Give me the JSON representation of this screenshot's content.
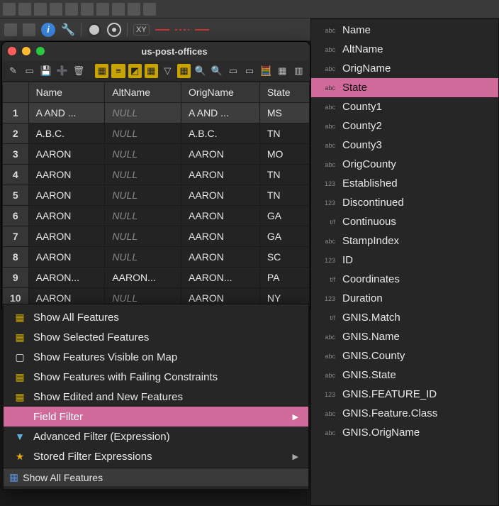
{
  "window": {
    "title": "us-post-offices"
  },
  "table": {
    "columns": [
      "Name",
      "AltName",
      "OrigName",
      "State"
    ],
    "rows": [
      {
        "n": "1",
        "Name": "A AND ...",
        "AltName": null,
        "OrigName": "A AND ...",
        "State": "MS",
        "selected": true
      },
      {
        "n": "2",
        "Name": "A.B.C.",
        "AltName": null,
        "OrigName": "A.B.C.",
        "State": "TN"
      },
      {
        "n": "3",
        "Name": "AARON",
        "AltName": null,
        "OrigName": "AARON",
        "State": "MO"
      },
      {
        "n": "4",
        "Name": "AARON",
        "AltName": null,
        "OrigName": "AARON",
        "State": "TN"
      },
      {
        "n": "5",
        "Name": "AARON",
        "AltName": null,
        "OrigName": "AARON",
        "State": "TN"
      },
      {
        "n": "6",
        "Name": "AARON",
        "AltName": null,
        "OrigName": "AARON",
        "State": "GA"
      },
      {
        "n": "7",
        "Name": "AARON",
        "AltName": null,
        "OrigName": "AARON",
        "State": "GA"
      },
      {
        "n": "8",
        "Name": "AARON",
        "AltName": null,
        "OrigName": "AARON",
        "State": "SC"
      },
      {
        "n": "9",
        "Name": "AARON...",
        "AltName": "AARON...",
        "OrigName": "AARON...",
        "State": "PA"
      },
      {
        "n": "10",
        "Name": "AARON",
        "AltName": null,
        "OrigName": "AARON",
        "State": "NY"
      }
    ],
    "null_label": "NULL"
  },
  "context_menu": {
    "items": [
      {
        "label": "Show All Features",
        "icon": "grid"
      },
      {
        "label": "Show Selected Features",
        "icon": "grid-sel"
      },
      {
        "label": "Show Features Visible on Map",
        "icon": "map"
      },
      {
        "label": "Show Features with Failing Constraints",
        "icon": "warn"
      },
      {
        "label": "Show Edited and New Features",
        "icon": "edit"
      },
      {
        "label": "Field Filter",
        "icon": "",
        "highlight": true,
        "submenu": true
      },
      {
        "label": "Advanced Filter (Expression)",
        "icon": "funnel"
      },
      {
        "label": "Stored Filter Expressions",
        "icon": "star",
        "submenu": true
      }
    ],
    "status": {
      "icon": "grid",
      "label": "Show All Features"
    }
  },
  "field_menu": {
    "items": [
      {
        "type": "abc",
        "label": "Name"
      },
      {
        "type": "abc",
        "label": "AltName"
      },
      {
        "type": "abc",
        "label": "OrigName"
      },
      {
        "type": "abc",
        "label": "State",
        "highlight": true
      },
      {
        "type": "abc",
        "label": "County1"
      },
      {
        "type": "abc",
        "label": "County2"
      },
      {
        "type": "abc",
        "label": "County3"
      },
      {
        "type": "abc",
        "label": "OrigCounty"
      },
      {
        "type": "123",
        "label": "Established"
      },
      {
        "type": "123",
        "label": "Discontinued"
      },
      {
        "type": "t/f",
        "label": "Continuous"
      },
      {
        "type": "abc",
        "label": "StampIndex"
      },
      {
        "type": "123",
        "label": "ID"
      },
      {
        "type": "t/f",
        "label": "Coordinates"
      },
      {
        "type": "123",
        "label": "Duration"
      },
      {
        "type": "t/f",
        "label": "GNIS.Match"
      },
      {
        "type": "abc",
        "label": "GNIS.Name"
      },
      {
        "type": "abc",
        "label": "GNIS.County"
      },
      {
        "type": "abc",
        "label": "GNIS.State"
      },
      {
        "type": "123",
        "label": "GNIS.FEATURE_ID"
      },
      {
        "type": "abc",
        "label": "GNIS.Feature.Class"
      },
      {
        "type": "abc",
        "label": "GNIS.OrigName"
      }
    ]
  }
}
